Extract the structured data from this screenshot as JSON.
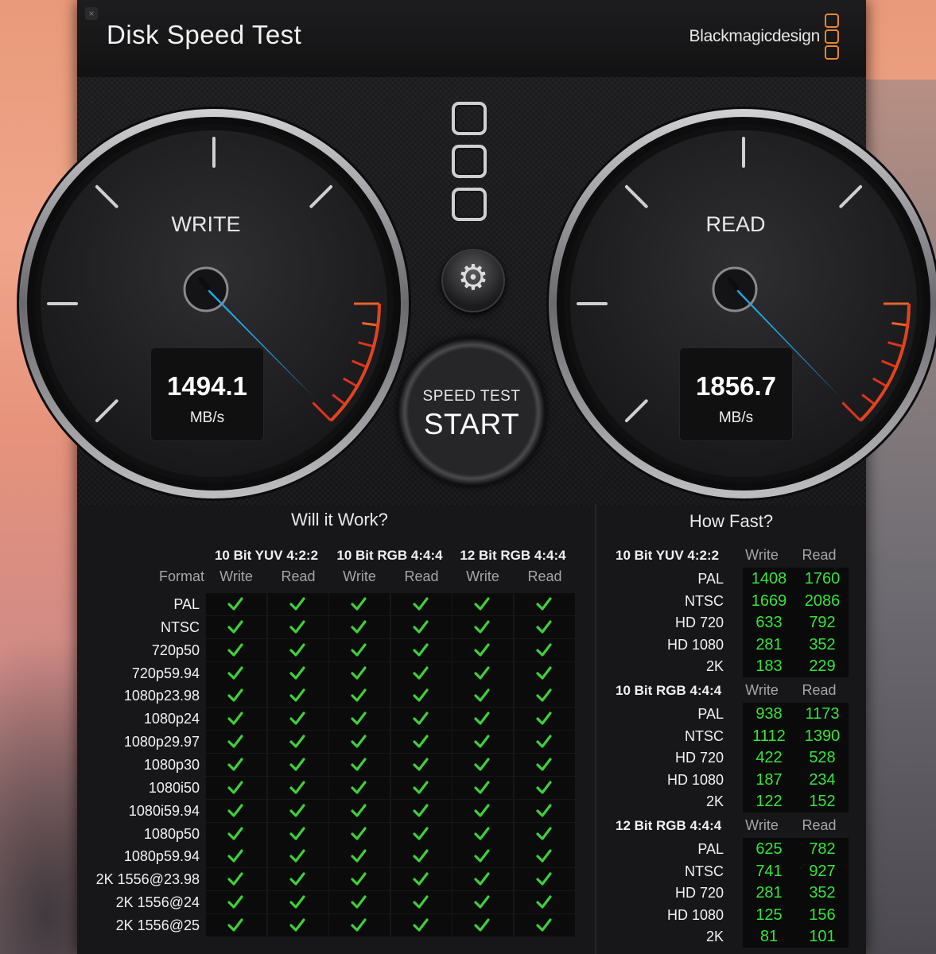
{
  "window": {
    "close_glyph": "×",
    "title": "Disk Speed Test",
    "brand": "Blackmagicdesign"
  },
  "gauges": {
    "write": {
      "label": "WRITE",
      "value": "1494.1",
      "unit": "MB/s"
    },
    "read": {
      "label": "READ",
      "value": "1856.7",
      "unit": "MB/s"
    }
  },
  "controls": {
    "gear_icon": "settings-gear-icon",
    "start_small": "SPEED TEST",
    "start_big": "START"
  },
  "will_it_work": {
    "title": "Will it Work?",
    "format_label": "Format",
    "groups": [
      "10 Bit YUV 4:2:2",
      "10 Bit RGB 4:4:4",
      "12 Bit RGB 4:4:4"
    ],
    "sub_labels": [
      "Write",
      "Read",
      "Write",
      "Read",
      "Write",
      "Read"
    ],
    "rows": [
      {
        "format": "PAL",
        "checks": [
          true,
          true,
          true,
          true,
          true,
          true
        ]
      },
      {
        "format": "NTSC",
        "checks": [
          true,
          true,
          true,
          true,
          true,
          true
        ]
      },
      {
        "format": "720p50",
        "checks": [
          true,
          true,
          true,
          true,
          true,
          true
        ]
      },
      {
        "format": "720p59.94",
        "checks": [
          true,
          true,
          true,
          true,
          true,
          true
        ]
      },
      {
        "format": "1080p23.98",
        "checks": [
          true,
          true,
          true,
          true,
          true,
          true
        ]
      },
      {
        "format": "1080p24",
        "checks": [
          true,
          true,
          true,
          true,
          true,
          true
        ]
      },
      {
        "format": "1080p29.97",
        "checks": [
          true,
          true,
          true,
          true,
          true,
          true
        ]
      },
      {
        "format": "1080p30",
        "checks": [
          true,
          true,
          true,
          true,
          true,
          true
        ]
      },
      {
        "format": "1080i50",
        "checks": [
          true,
          true,
          true,
          true,
          true,
          true
        ]
      },
      {
        "format": "1080i59.94",
        "checks": [
          true,
          true,
          true,
          true,
          true,
          true
        ]
      },
      {
        "format": "1080p50",
        "checks": [
          true,
          true,
          true,
          true,
          true,
          true
        ]
      },
      {
        "format": "1080p59.94",
        "checks": [
          true,
          true,
          true,
          true,
          true,
          true
        ]
      },
      {
        "format": "2K 1556@23.98",
        "checks": [
          true,
          true,
          true,
          true,
          true,
          true
        ]
      },
      {
        "format": "2K 1556@24",
        "checks": [
          true,
          true,
          true,
          true,
          true,
          true
        ]
      },
      {
        "format": "2K 1556@25",
        "checks": [
          true,
          true,
          true,
          true,
          true,
          true
        ]
      }
    ]
  },
  "how_fast": {
    "title": "How Fast?",
    "write_label": "Write",
    "read_label": "Read",
    "groups": [
      {
        "name": "10 Bit YUV 4:2:2",
        "rows": [
          {
            "format": "PAL",
            "write": "1408",
            "read": "1760"
          },
          {
            "format": "NTSC",
            "write": "1669",
            "read": "2086"
          },
          {
            "format": "HD 720",
            "write": "633",
            "read": "792"
          },
          {
            "format": "HD 1080",
            "write": "281",
            "read": "352"
          },
          {
            "format": "2K",
            "write": "183",
            "read": "229"
          }
        ]
      },
      {
        "name": "10 Bit RGB 4:4:4",
        "rows": [
          {
            "format": "PAL",
            "write": "938",
            "read": "1173"
          },
          {
            "format": "NTSC",
            "write": "1112",
            "read": "1390"
          },
          {
            "format": "HD 720",
            "write": "422",
            "read": "528"
          },
          {
            "format": "HD 1080",
            "write": "187",
            "read": "234"
          },
          {
            "format": "2K",
            "write": "122",
            "read": "152"
          }
        ]
      },
      {
        "name": "12 Bit RGB 4:4:4",
        "rows": [
          {
            "format": "PAL",
            "write": "625",
            "read": "782"
          },
          {
            "format": "NTSC",
            "write": "741",
            "read": "927"
          },
          {
            "format": "HD 720",
            "write": "281",
            "read": "352"
          },
          {
            "format": "HD 1080",
            "write": "125",
            "read": "156"
          },
          {
            "format": "2K",
            "write": "81",
            "read": "101"
          }
        ]
      }
    ]
  },
  "colors": {
    "needle": "#21a7e6",
    "redline": "#e2441f",
    "value_green": "#35e43a",
    "brand_orange": "#e8882b",
    "check_green": "#3fcf3a"
  }
}
